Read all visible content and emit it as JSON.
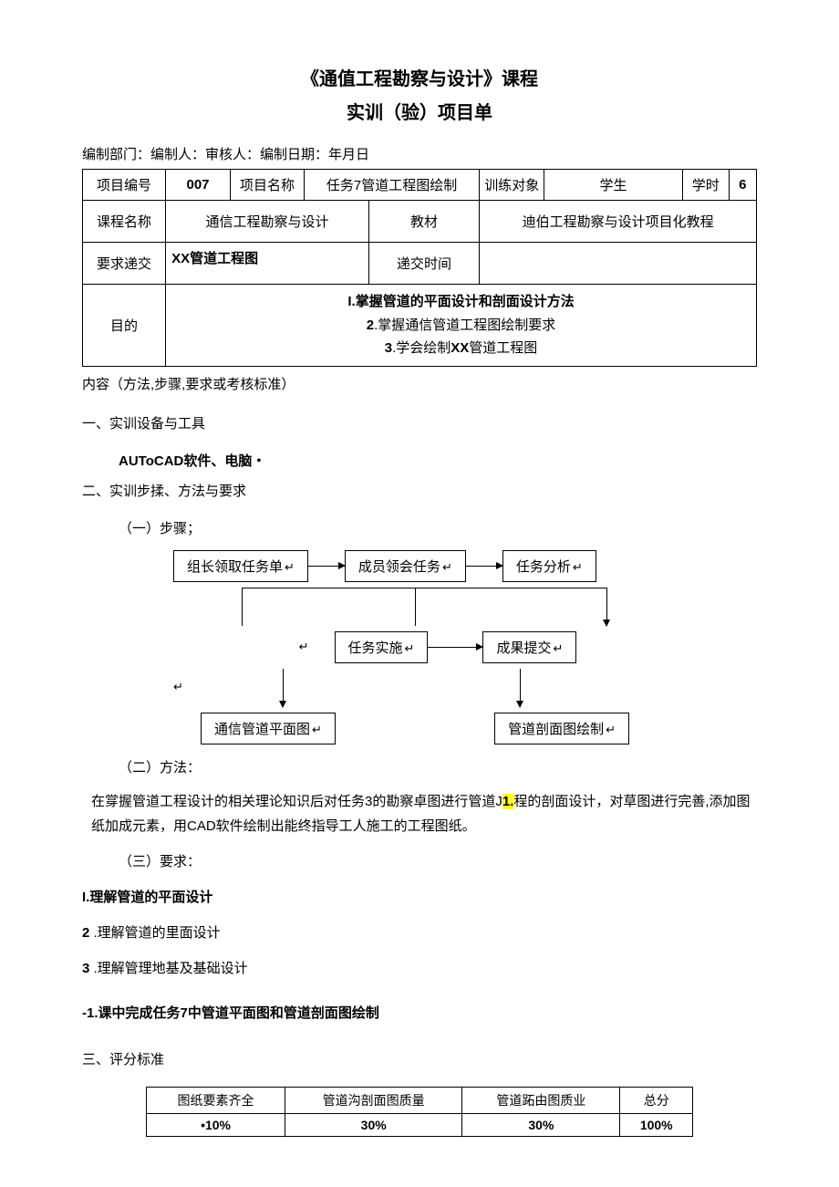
{
  "title": "《通值工程勘察与设计》课程",
  "subtitle": "实训（验）项目单",
  "meta_line": "编制部门：编制人：审核人：编制日期：年月日",
  "table": {
    "r1": {
      "c1": "项目编号",
      "c2": "007",
      "c3": "项目名称",
      "c4": "任务7管道工程图绘制",
      "c5": "训练对象",
      "c6": "学生",
      "c7": "学时",
      "c8": "6"
    },
    "r2": {
      "c1": "课程名称",
      "c2": "通信工程勘察与设计",
      "c3": "教材",
      "c4": "迪伯工程勘察与设计项目化教程"
    },
    "r3": {
      "c1": "要求递交",
      "c2": "XX管道工程图",
      "c3": "递交时间",
      "c4": ""
    },
    "r4": {
      "c1": "目的",
      "g1": "I.掌握管道的平面设计和剖面设计方法",
      "g2": "2.掌握通信管道工程图绘制要求",
      "g3": "3.学会绘制XX管道工程图"
    }
  },
  "content_label": "内容（方法,步骤,要求或考核标准）",
  "sec1": "一、实训设备与工具",
  "sec1_body": "AUToCAD软件、电脑・",
  "sec2": "二、实训步揉、方法与要求",
  "sec2_sub1": "（一）步骤；",
  "flow": {
    "b1": "组长领取任务单",
    "b2": "成员领会任务",
    "b3": "任务分析",
    "b4": "任务实施",
    "b5": "成果提交",
    "b6": "通信管道平面图",
    "b7": "管道剖面图绘制"
  },
  "sec2_sub2": "（二）方法：",
  "method_pre": "在牚握管道工程设计的相关理论知识后对任务3的勘察卓图进行管道J",
  "method_hl": "1.",
  "method_post": "程的剖面设计，对草图进行完善,添加图纸加成元素，用CAD软件绘制出能终指导工人施工的工程图纸。",
  "sec2_sub3": "（三）要求：",
  "req1": "I.理解管道的平面设计",
  "req2_n": "2",
  "req2": "   .理解管道的里面设计",
  "req3_n": "3",
  "req3": "   .理解管理地基及基础设计",
  "req4": "-1.课中完成任务7中管道平面图和管道剖面图绘制",
  "sec3": "三、评分标准",
  "score": {
    "h1": "图纸要素齐全",
    "h2": "管道沟剖面图质量",
    "h3": "管道跖由图质业",
    "h4": "总分",
    "v1": "•10%",
    "v2": "30%",
    "v3": "30%",
    "v4": "100%"
  }
}
